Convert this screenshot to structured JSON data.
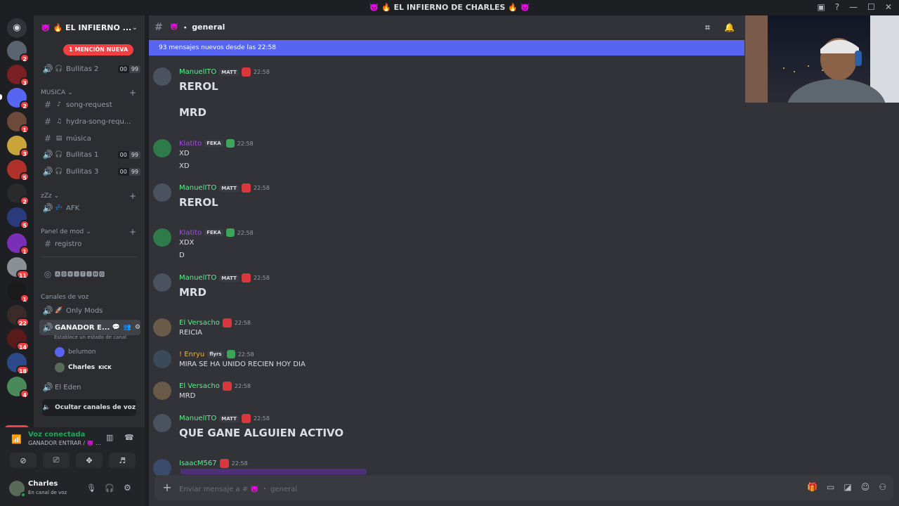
{
  "window": {
    "title": "👿 🔥 EL INFIERNO DE CHARLES 🔥 👿"
  },
  "servers": {
    "badges": [
      "2",
      "3",
      "2",
      "1",
      "3",
      "5",
      "2",
      "5",
      "1",
      "11",
      "1",
      "22",
      "14",
      "18",
      "4"
    ],
    "nuevo": "NUEVO"
  },
  "guild": {
    "name": "👿 🔥 EL INFIERNO ...",
    "mention_pill": "1 MENCIÓN NUEVA"
  },
  "channels": {
    "bullitas2": {
      "name": "Bullitas 2",
      "limit_a": "00",
      "limit_b": "99"
    },
    "cat_musica": "MUSICA",
    "song_request": "song-request",
    "hydra": "hydra-song-requ...",
    "musica": "música",
    "bullitas1": {
      "name": "Bullitas 1",
      "limit_a": "00",
      "limit_b": "99"
    },
    "bullitas3": {
      "name": "Bullitas 3",
      "limit_a": "00",
      "limit_b": "99"
    },
    "cat_zzz": "zZz",
    "afk": "AFK",
    "cat_mod": "Panel de mod",
    "registro": "registro",
    "ruleta": "🅰🅳🆅🅸🆃🅸🅼🅾",
    "cat_voz": "Canales de voz",
    "only_mods": "Only Mods",
    "ganador": "GANADOR E...",
    "ganador_status": "Establece un estado de canal",
    "voice_users": [
      {
        "name": "belumon"
      },
      {
        "name": "Charles",
        "tag": "KICK"
      }
    ],
    "el_eden": "El Eden",
    "hide_voice": "Ocultar canales de voz"
  },
  "voice_panel": {
    "status": "Voz conectada",
    "channel": "GANADOR ENTRAR / 👿 ..."
  },
  "user_panel": {
    "name": "Charles",
    "status": "En canal de voz"
  },
  "chat": {
    "channel_name": "general",
    "new_messages": "93 mensajes nuevos desde las 22:58",
    "messages": [
      {
        "author": "ManuelITO",
        "tag": "MATT",
        "time": "22:58",
        "lines": [
          "REROL",
          "MRD"
        ],
        "color": "#57f287"
      },
      {
        "author": "Klatito",
        "tag": "FEKA",
        "time": "22:58",
        "lines": [
          "XD",
          "XD"
        ],
        "color": "#a04ce0"
      },
      {
        "author": "ManuelITO",
        "tag": "MATT",
        "time": "22:58",
        "lines": [
          "REROL"
        ],
        "color": "#57f287"
      },
      {
        "author": "Klatito",
        "tag": "FEKA",
        "time": "22:58",
        "lines": [
          "XDX",
          "D"
        ],
        "color": "#a04ce0"
      },
      {
        "author": "ManuelITO",
        "tag": "MATT",
        "time": "22:58",
        "lines": [
          "MRD"
        ],
        "color": "#57f287"
      },
      {
        "author": "El Versacho",
        "tag": "",
        "time": "22:58",
        "lines": [
          "REICIA"
        ],
        "color": "#57f287"
      },
      {
        "author": "! Enryu",
        "tag": "flyrs",
        "time": "22:58",
        "lines": [
          "MIRA SE HA UNIDO RECIEN HOY DIA"
        ],
        "color": "#f0b232"
      },
      {
        "author": "El Versacho",
        "tag": "",
        "time": "22:58",
        "lines": [
          "MRD"
        ],
        "color": "#57f287"
      },
      {
        "author": "ManuelITO",
        "tag": "MATT",
        "time": "22:58",
        "lines": [
          "QUE GANE ALGUIEN ACTIVO"
        ],
        "color": "#57f287"
      },
      {
        "author": "IsaacM567",
        "tag": "",
        "time": "22:58",
        "lines": [],
        "color": "#57f287"
      }
    ],
    "input_placeholder": "Enviar mensaje a # 👿 ・ general"
  }
}
